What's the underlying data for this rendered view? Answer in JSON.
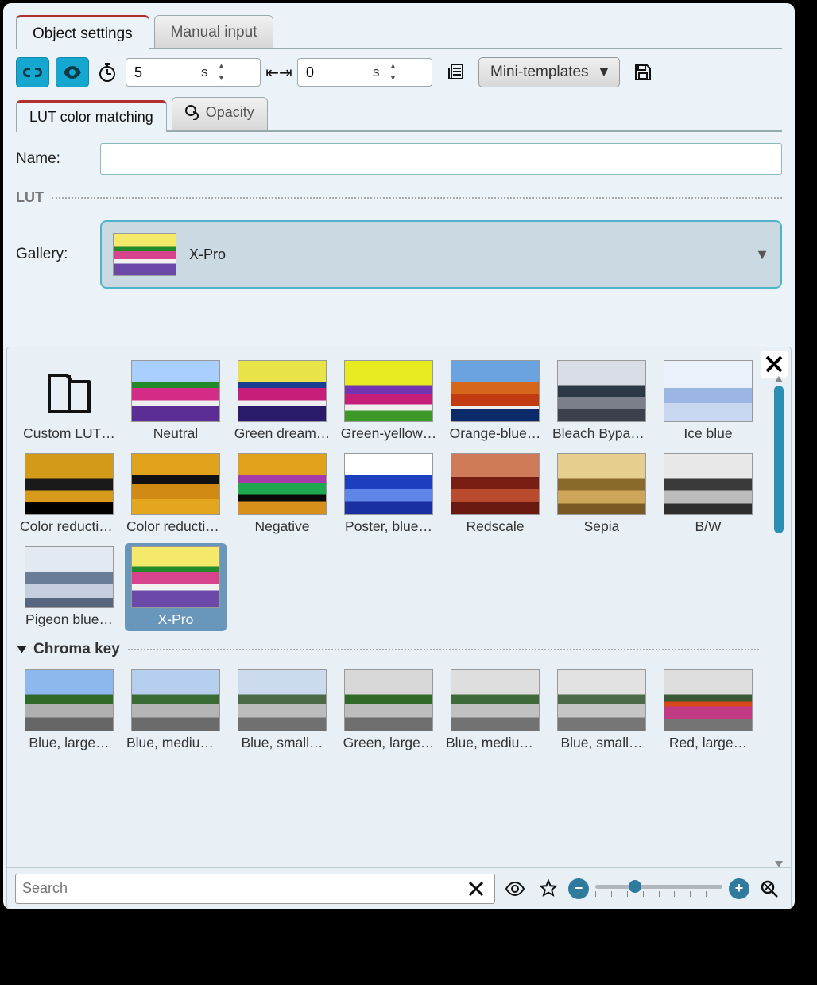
{
  "top_tabs": {
    "object_settings": "Object settings",
    "manual_input": "Manual input"
  },
  "toolbar": {
    "duration_value": "5",
    "duration_unit": "s",
    "offset_value": "0",
    "offset_unit": "s",
    "mini_templates": "Mini-templates"
  },
  "sub_tabs": {
    "lut": "LUT color matching",
    "opacity": "Opacity"
  },
  "name_label": "Name:",
  "name_value": "",
  "lut_header": "LUT",
  "gallery_label": "Gallery:",
  "gallery_selected": "X-Pro",
  "section_chroma": "Chroma key",
  "gallery_items": {
    "custom": "Custom LUT…",
    "neutral": "Neutral",
    "green_dream": "Green dream…",
    "green_yellow": "Green-yellow…",
    "orange_blue": "Orange-blue…",
    "bleach": "Bleach Bypass…",
    "ice": "Ice blue",
    "color_red_a": "Color reduction…",
    "color_red_b": "Color reduction…",
    "negative": "Negative",
    "poster": "Poster, blue…",
    "redscale": "Redscale",
    "sepia": "Sepia",
    "bw": "B/W",
    "pigeon": "Pigeon blue…",
    "xpro": "X-Pro"
  },
  "chroma_items": {
    "blue_large": "Blue, large…",
    "blue_med": "Blue, medium…",
    "blue_small": "Blue, small…",
    "green_large": "Green, large…",
    "blue_med2": "Blue, medium…",
    "blue_small2": "Blue, small…",
    "red_large": "Red, large…"
  },
  "search_placeholder": "Search"
}
